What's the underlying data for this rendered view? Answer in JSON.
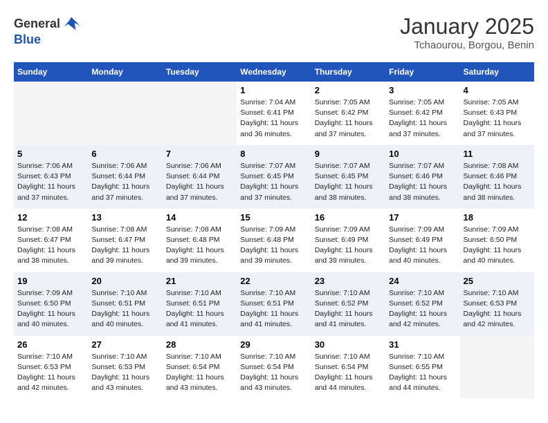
{
  "header": {
    "logo_general": "General",
    "logo_blue": "Blue",
    "month_title": "January 2025",
    "location": "Tchaourou, Borgou, Benin"
  },
  "days_of_week": [
    "Sunday",
    "Monday",
    "Tuesday",
    "Wednesday",
    "Thursday",
    "Friday",
    "Saturday"
  ],
  "weeks": [
    [
      {
        "num": "",
        "info": ""
      },
      {
        "num": "",
        "info": ""
      },
      {
        "num": "",
        "info": ""
      },
      {
        "num": "1",
        "info": "Sunrise: 7:04 AM\nSunset: 6:41 PM\nDaylight: 11 hours and 36 minutes."
      },
      {
        "num": "2",
        "info": "Sunrise: 7:05 AM\nSunset: 6:42 PM\nDaylight: 11 hours and 37 minutes."
      },
      {
        "num": "3",
        "info": "Sunrise: 7:05 AM\nSunset: 6:42 PM\nDaylight: 11 hours and 37 minutes."
      },
      {
        "num": "4",
        "info": "Sunrise: 7:05 AM\nSunset: 6:43 PM\nDaylight: 11 hours and 37 minutes."
      }
    ],
    [
      {
        "num": "5",
        "info": "Sunrise: 7:06 AM\nSunset: 6:43 PM\nDaylight: 11 hours and 37 minutes."
      },
      {
        "num": "6",
        "info": "Sunrise: 7:06 AM\nSunset: 6:44 PM\nDaylight: 11 hours and 37 minutes."
      },
      {
        "num": "7",
        "info": "Sunrise: 7:06 AM\nSunset: 6:44 PM\nDaylight: 11 hours and 37 minutes."
      },
      {
        "num": "8",
        "info": "Sunrise: 7:07 AM\nSunset: 6:45 PM\nDaylight: 11 hours and 37 minutes."
      },
      {
        "num": "9",
        "info": "Sunrise: 7:07 AM\nSunset: 6:45 PM\nDaylight: 11 hours and 38 minutes."
      },
      {
        "num": "10",
        "info": "Sunrise: 7:07 AM\nSunset: 6:46 PM\nDaylight: 11 hours and 38 minutes."
      },
      {
        "num": "11",
        "info": "Sunrise: 7:08 AM\nSunset: 6:46 PM\nDaylight: 11 hours and 38 minutes."
      }
    ],
    [
      {
        "num": "12",
        "info": "Sunrise: 7:08 AM\nSunset: 6:47 PM\nDaylight: 11 hours and 38 minutes."
      },
      {
        "num": "13",
        "info": "Sunrise: 7:08 AM\nSunset: 6:47 PM\nDaylight: 11 hours and 39 minutes."
      },
      {
        "num": "14",
        "info": "Sunrise: 7:08 AM\nSunset: 6:48 PM\nDaylight: 11 hours and 39 minutes."
      },
      {
        "num": "15",
        "info": "Sunrise: 7:09 AM\nSunset: 6:48 PM\nDaylight: 11 hours and 39 minutes."
      },
      {
        "num": "16",
        "info": "Sunrise: 7:09 AM\nSunset: 6:49 PM\nDaylight: 11 hours and 39 minutes."
      },
      {
        "num": "17",
        "info": "Sunrise: 7:09 AM\nSunset: 6:49 PM\nDaylight: 11 hours and 40 minutes."
      },
      {
        "num": "18",
        "info": "Sunrise: 7:09 AM\nSunset: 6:50 PM\nDaylight: 11 hours and 40 minutes."
      }
    ],
    [
      {
        "num": "19",
        "info": "Sunrise: 7:09 AM\nSunset: 6:50 PM\nDaylight: 11 hours and 40 minutes."
      },
      {
        "num": "20",
        "info": "Sunrise: 7:10 AM\nSunset: 6:51 PM\nDaylight: 11 hours and 40 minutes."
      },
      {
        "num": "21",
        "info": "Sunrise: 7:10 AM\nSunset: 6:51 PM\nDaylight: 11 hours and 41 minutes."
      },
      {
        "num": "22",
        "info": "Sunrise: 7:10 AM\nSunset: 6:51 PM\nDaylight: 11 hours and 41 minutes."
      },
      {
        "num": "23",
        "info": "Sunrise: 7:10 AM\nSunset: 6:52 PM\nDaylight: 11 hours and 41 minutes."
      },
      {
        "num": "24",
        "info": "Sunrise: 7:10 AM\nSunset: 6:52 PM\nDaylight: 11 hours and 42 minutes."
      },
      {
        "num": "25",
        "info": "Sunrise: 7:10 AM\nSunset: 6:53 PM\nDaylight: 11 hours and 42 minutes."
      }
    ],
    [
      {
        "num": "26",
        "info": "Sunrise: 7:10 AM\nSunset: 6:53 PM\nDaylight: 11 hours and 42 minutes."
      },
      {
        "num": "27",
        "info": "Sunrise: 7:10 AM\nSunset: 6:53 PM\nDaylight: 11 hours and 43 minutes."
      },
      {
        "num": "28",
        "info": "Sunrise: 7:10 AM\nSunset: 6:54 PM\nDaylight: 11 hours and 43 minutes."
      },
      {
        "num": "29",
        "info": "Sunrise: 7:10 AM\nSunset: 6:54 PM\nDaylight: 11 hours and 43 minutes."
      },
      {
        "num": "30",
        "info": "Sunrise: 7:10 AM\nSunset: 6:54 PM\nDaylight: 11 hours and 44 minutes."
      },
      {
        "num": "31",
        "info": "Sunrise: 7:10 AM\nSunset: 6:55 PM\nDaylight: 11 hours and 44 minutes."
      },
      {
        "num": "",
        "info": ""
      }
    ]
  ]
}
